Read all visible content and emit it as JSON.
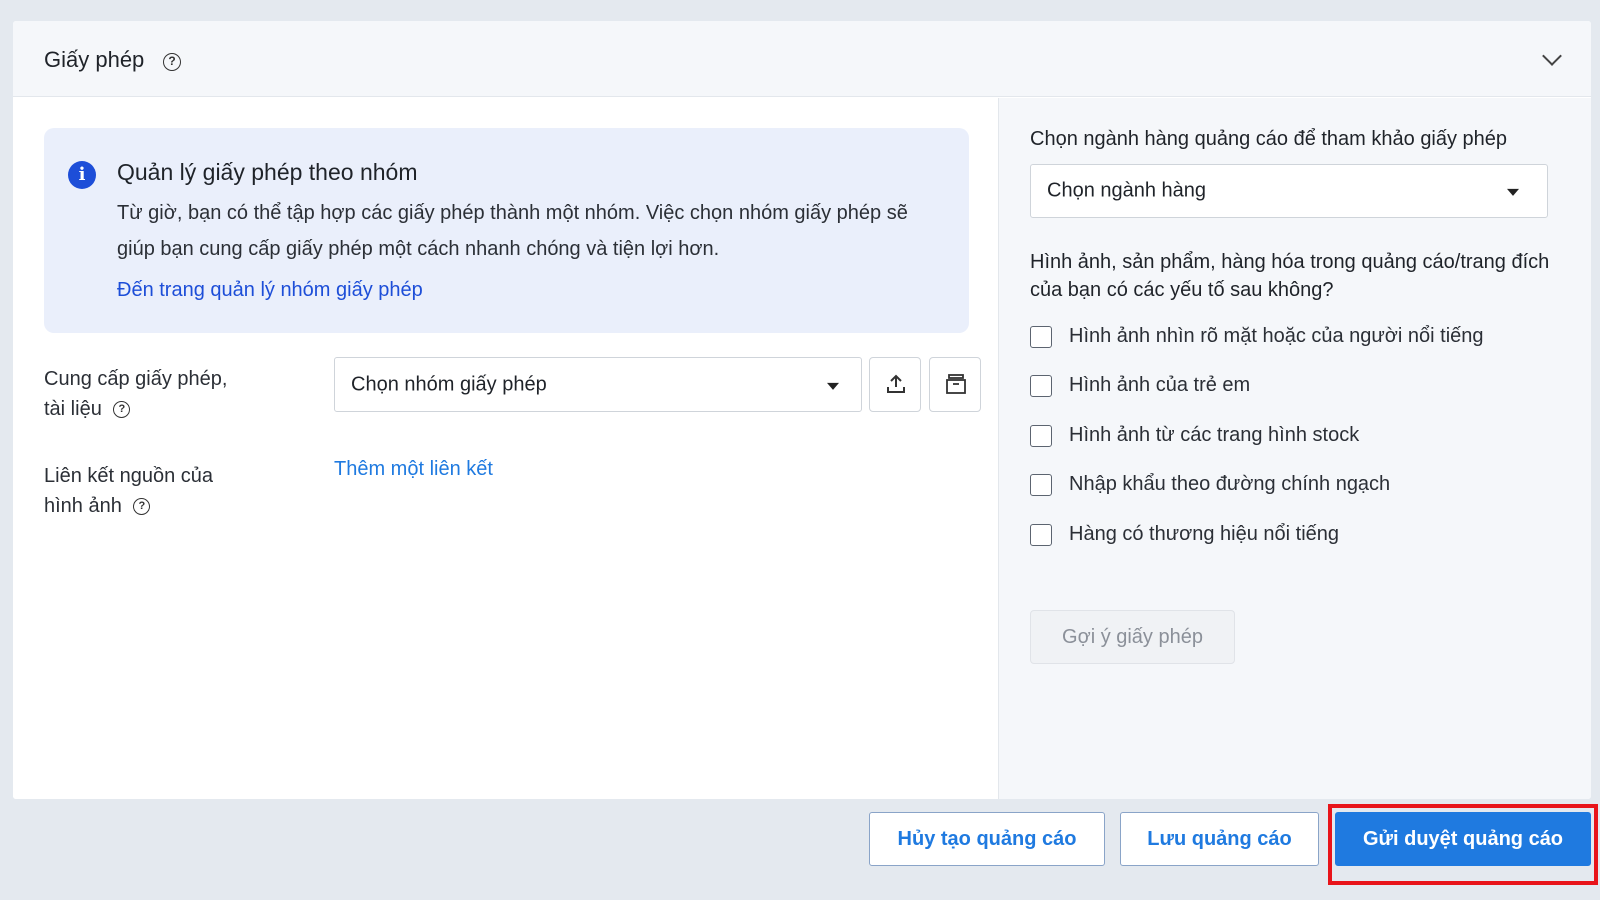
{
  "section": {
    "title": "Giấy phép"
  },
  "info_box": {
    "title": "Quản lý giấy phép theo nhóm",
    "description": "Từ giờ, bạn có thể tập hợp các giấy phép thành một nhóm. Việc chọn nhóm giấy phép sẽ giúp bạn cung cấp giấy phép một cách nhanh chóng và tiện lợi hơn.",
    "link": "Đến trang quản lý nhóm giấy phép"
  },
  "license_field": {
    "label_line1": "Cung cấp giấy phép,",
    "label_line2": "tài liệu",
    "select_value": "Chọn nhóm giấy phép"
  },
  "source_link_field": {
    "label_line1": "Liên kết nguồn của",
    "label_line2": "hình ảnh",
    "add_link": "Thêm một liên kết"
  },
  "right_panel": {
    "industry_label": "Chọn ngành hàng quảng cáo để tham khảo giấy phép",
    "industry_select": "Chọn ngành hàng",
    "question": "Hình ảnh, sản phẩm, hàng hóa trong quảng cáo/trang đích của bạn có các yếu tố sau không?",
    "options": [
      {
        "label": "Hình ảnh nhìn rõ mặt hoặc của người nổi tiếng",
        "checked": false
      },
      {
        "label": "Hình ảnh của trẻ em",
        "checked": false
      },
      {
        "label": "Hình ảnh từ các trang hình stock",
        "checked": false
      },
      {
        "label": "Nhập khẩu theo đường chính ngạch",
        "checked": false
      },
      {
        "label": "Hàng có thương hiệu nổi tiếng",
        "checked": false
      }
    ],
    "suggest_button": "Gợi ý giấy phép"
  },
  "footer": {
    "cancel": "Hủy tạo quảng cáo",
    "save": "Lưu quảng cáo",
    "submit": "Gửi duyệt quảng cáo"
  },
  "colors": {
    "accent": "#1f7ae0",
    "link": "#1d4ed8",
    "info_bg": "#eaeffb",
    "highlight": "#e8141a"
  },
  "icons": [
    "help-icon",
    "chevron-down-icon",
    "info-icon",
    "upload-icon",
    "archive-icon",
    "caret-down-icon"
  ]
}
